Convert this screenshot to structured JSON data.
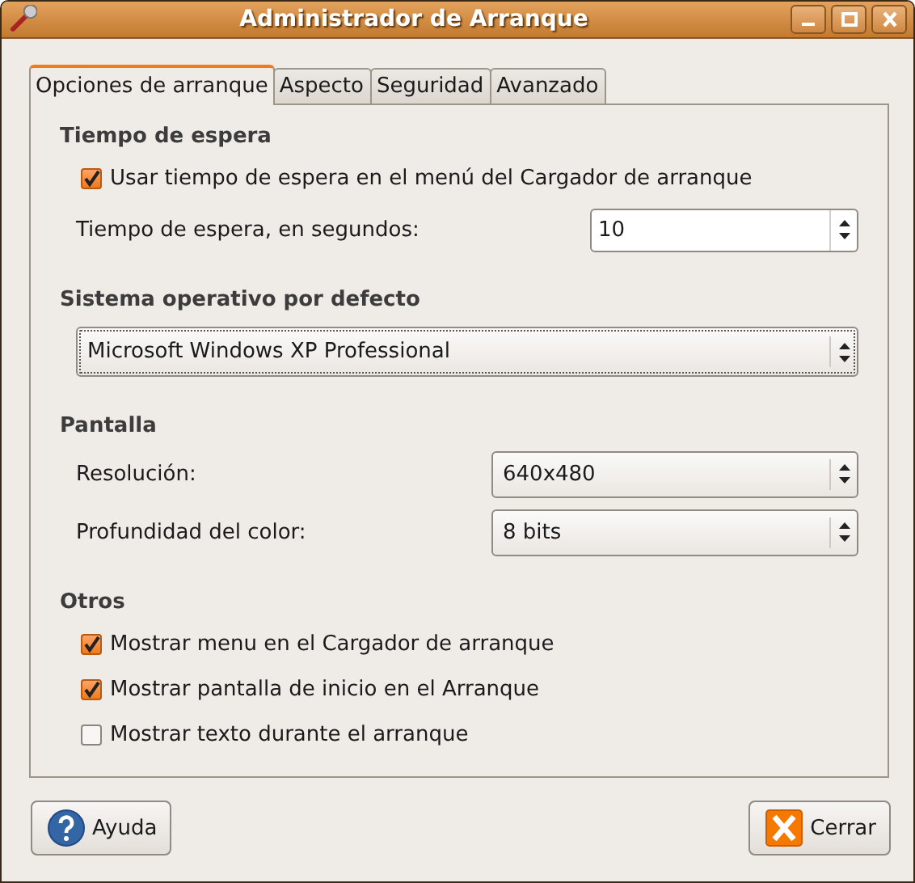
{
  "window": {
    "title": "Administrador de Arranque",
    "controls": [
      {
        "kind": "minimize"
      },
      {
        "kind": "maximize"
      },
      {
        "kind": "close"
      }
    ]
  },
  "tabs": [
    {
      "label": "Opciones de arranque",
      "selected": true
    },
    {
      "label": "Aspecto",
      "selected": false
    },
    {
      "label": "Seguridad",
      "selected": false
    },
    {
      "label": "Avanzado",
      "selected": false
    }
  ],
  "sections": [
    {
      "heading": "Tiempo de espera",
      "rows": [
        {
          "kind": "checkbox",
          "label": "Usar tiempo de espera en el menú del Cargador de arranque",
          "checked": true
        },
        {
          "kind": "spin",
          "label": "Tiempo de espera, en segundos:",
          "value": "10"
        }
      ]
    },
    {
      "heading": "Sistema operativo por defecto",
      "rows": [
        {
          "kind": "combo-wide",
          "value": "Microsoft Windows XP Professional"
        }
      ]
    },
    {
      "heading": "Pantalla",
      "rows": [
        {
          "kind": "combo",
          "label": "Resolución:",
          "value": "640x480"
        },
        {
          "kind": "combo",
          "label": "Profundidad del color:",
          "value": "8 bits"
        }
      ]
    },
    {
      "heading": "Otros",
      "rows": [
        {
          "kind": "checkbox",
          "label": "Mostrar menu en el Cargador de arranque",
          "checked": true
        },
        {
          "kind": "checkbox",
          "label": "Mostrar pantalla de inicio en el Arranque",
          "checked": true
        },
        {
          "kind": "checkbox",
          "label": "Mostrar texto durante el arranque",
          "checked": false
        }
      ]
    }
  ],
  "buttons": [
    {
      "kind": "help",
      "label": "Ayuda"
    },
    {
      "kind": "close",
      "label": "Cerrar"
    }
  ]
}
